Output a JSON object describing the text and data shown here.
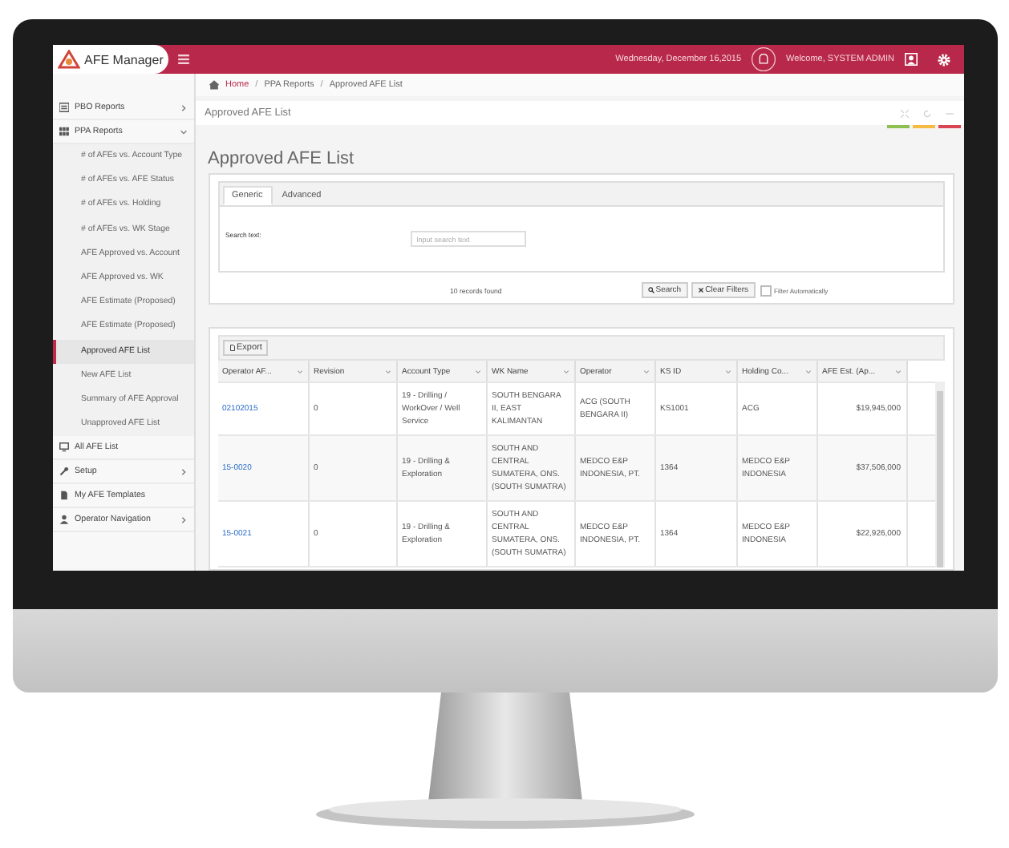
{
  "header": {
    "app_name": "AFE Manager",
    "date": "Wednesday, December 16,2015",
    "welcome": "Welcome, SYSTEM ADMIN"
  },
  "breadcrumb": {
    "separator": "/",
    "items": [
      "Home",
      "PPA Reports",
      "Approved AFE List"
    ]
  },
  "sidebar": {
    "items": [
      {
        "label": "PBO Reports",
        "expanded": false
      },
      {
        "label": "PPA Reports",
        "expanded": true,
        "children": [
          {
            "label": "# of AFEs vs. Account Type",
            "selected": false
          },
          {
            "label": "# of AFEs vs. AFE Status",
            "selected": false
          },
          {
            "label": "# of AFEs vs. Holding",
            "selected": false
          },
          {
            "label": "# of AFEs vs. WK Stage",
            "selected": false
          },
          {
            "label": "AFE Approved vs. Account",
            "selected": false
          },
          {
            "label": "AFE Approved vs. WK",
            "selected": false
          },
          {
            "label": "AFE Estimate (Proposed)",
            "selected": false
          },
          {
            "label": "AFE Estimate (Proposed)",
            "selected": false
          },
          {
            "label": "Approved AFE List",
            "selected": true
          },
          {
            "label": "New AFE List",
            "selected": false
          },
          {
            "label": "Summary of AFE Approval",
            "selected": false
          },
          {
            "label": "Unapproved AFE List",
            "selected": false
          }
        ]
      },
      {
        "label": "All AFE List"
      },
      {
        "label": "Setup",
        "expanded": false
      },
      {
        "label": "My AFE Templates"
      },
      {
        "label": "Operator Navigation",
        "expanded": false
      }
    ]
  },
  "page_title": "Approved AFE List",
  "heading": "Approved AFE List",
  "tabs": [
    {
      "label": "Generic",
      "selected": true
    },
    {
      "label": "Advanced",
      "selected": false
    }
  ],
  "search": {
    "label": "Search text:",
    "placeholder": "Input search text"
  },
  "records": "10 records found",
  "buttons": [
    "Search",
    "Clear Filters"
  ],
  "filter_automatically": {
    "label": "Filter Automatically",
    "checked": false
  },
  "export": "Export",
  "table": {
    "columns": [
      "Operator AF...",
      "Revision",
      "Account Type",
      "WK Name",
      "Operator",
      "KS ID",
      "Holding Co...",
      "AFE Est. (Ap..."
    ],
    "rows": [
      [
        "02102015",
        "0",
        "19 - Drilling / WorkOver / Well Service",
        "SOUTH BENGARA II, EAST KALIMANTAN",
        "ACG (SOUTH BENGARA II)",
        "KS1001",
        "ACG",
        "$19,945,000"
      ],
      [
        "15-0020",
        "0",
        "19 - Drilling & Exploration",
        "SOUTH AND CENTRAL SUMATERA, ONS. (SOUTH SUMATRA)",
        "MEDCO E&P INDONESIA, PT.",
        "1364",
        "MEDCO E&P INDONESIA",
        "$37,506,000"
      ],
      [
        "15-0021",
        "0",
        "19 - Drilling & Exploration",
        "SOUTH AND CENTRAL SUMATERA, ONS. (SOUTH SUMATRA)",
        "MEDCO E&P INDONESIA, PT.",
        "1364",
        "MEDCO E&P INDONESIA",
        "$22,926,000"
      ]
    ]
  }
}
